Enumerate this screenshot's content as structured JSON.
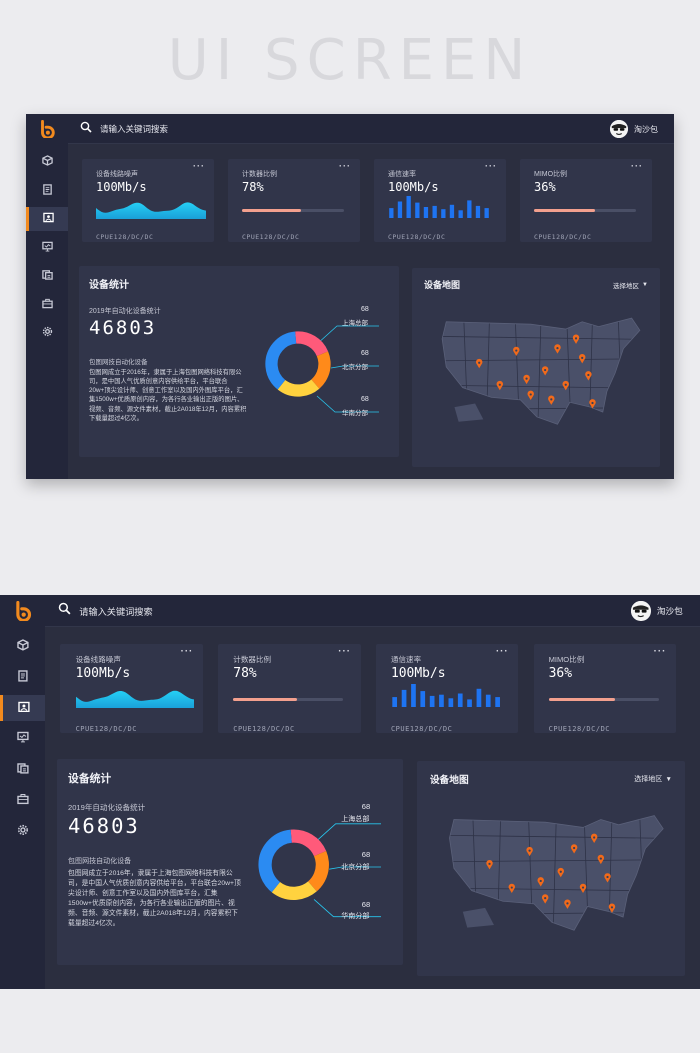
{
  "hero_title": "UI SCREEN",
  "search": {
    "placeholder": "请输入关键词搜索"
  },
  "user": {
    "name": "淘沙包"
  },
  "nav": {
    "items": [
      {
        "icon": "cube-icon",
        "active": false
      },
      {
        "icon": "document-icon",
        "active": false
      },
      {
        "icon": "image-icon",
        "active": true
      },
      {
        "icon": "monitor-icon",
        "active": false
      },
      {
        "icon": "database-icon",
        "active": false
      },
      {
        "icon": "briefcase-icon",
        "active": false
      },
      {
        "icon": "gear-icon",
        "active": false
      }
    ]
  },
  "cards": [
    {
      "title": "设备线路噪声",
      "value": "100Mb/s",
      "footer": "CPUE128/DC/DC",
      "visual": "wave"
    },
    {
      "title": "计数器比例",
      "value": "78%",
      "footer": "CPUE128/DC/DC",
      "visual": "progress",
      "progress": 0.58
    },
    {
      "title": "通信速率",
      "value": "100Mb/s",
      "footer": "CPUE128/DC/DC",
      "visual": "bars",
      "bars": [
        0.45,
        0.75,
        1.0,
        0.7,
        0.5,
        0.55,
        0.4,
        0.6,
        0.35,
        0.8,
        0.55,
        0.45
      ]
    },
    {
      "title": "MIMO比例",
      "value": "36%",
      "footer": "CPUE128/DC/DC",
      "visual": "progress",
      "progress": 0.6
    }
  ],
  "stats": {
    "title": "设备统计",
    "subtitle": "2019年自动化设备统计",
    "total": "46803",
    "intro_title": "包图网技自动化设备",
    "intro_body": "包图网成立于2016年，隶属于上海包图网络科技有限公司，是中国人气优质创意内容供给平台，平台联合20w+顶尖设计师、创意工作室以及国内外图库平台，汇集1500w+优质原创内容，为各行各业输出正版的图片、视频、音频、源文件素材，截止2A018年12月，内容累积下载量超过4亿次。",
    "donut": [
      {
        "name": "上海总部",
        "value": "68",
        "color": "#ff5a7a"
      },
      {
        "name": "北京分部",
        "value": "68",
        "color": "#ff8a1a"
      },
      {
        "name": "华南分部",
        "value": "68",
        "color": "#ffd23f"
      }
    ],
    "donut_fractions": [
      0.2,
      0.2,
      0.22,
      0.38
    ],
    "donut_colors": [
      "#ff5a7a",
      "#ff8a1a",
      "#ffd23f",
      "#2b8bf2"
    ]
  },
  "map": {
    "title": "设备地图",
    "select_label": "选择地区"
  },
  "colors": {
    "accent": "#f28a1e",
    "bg": "#2b2e3f",
    "panel": "#31354a",
    "cyan": "#1fc8f0",
    "blue": "#1e6ff0",
    "progress": "#f3a08e"
  }
}
